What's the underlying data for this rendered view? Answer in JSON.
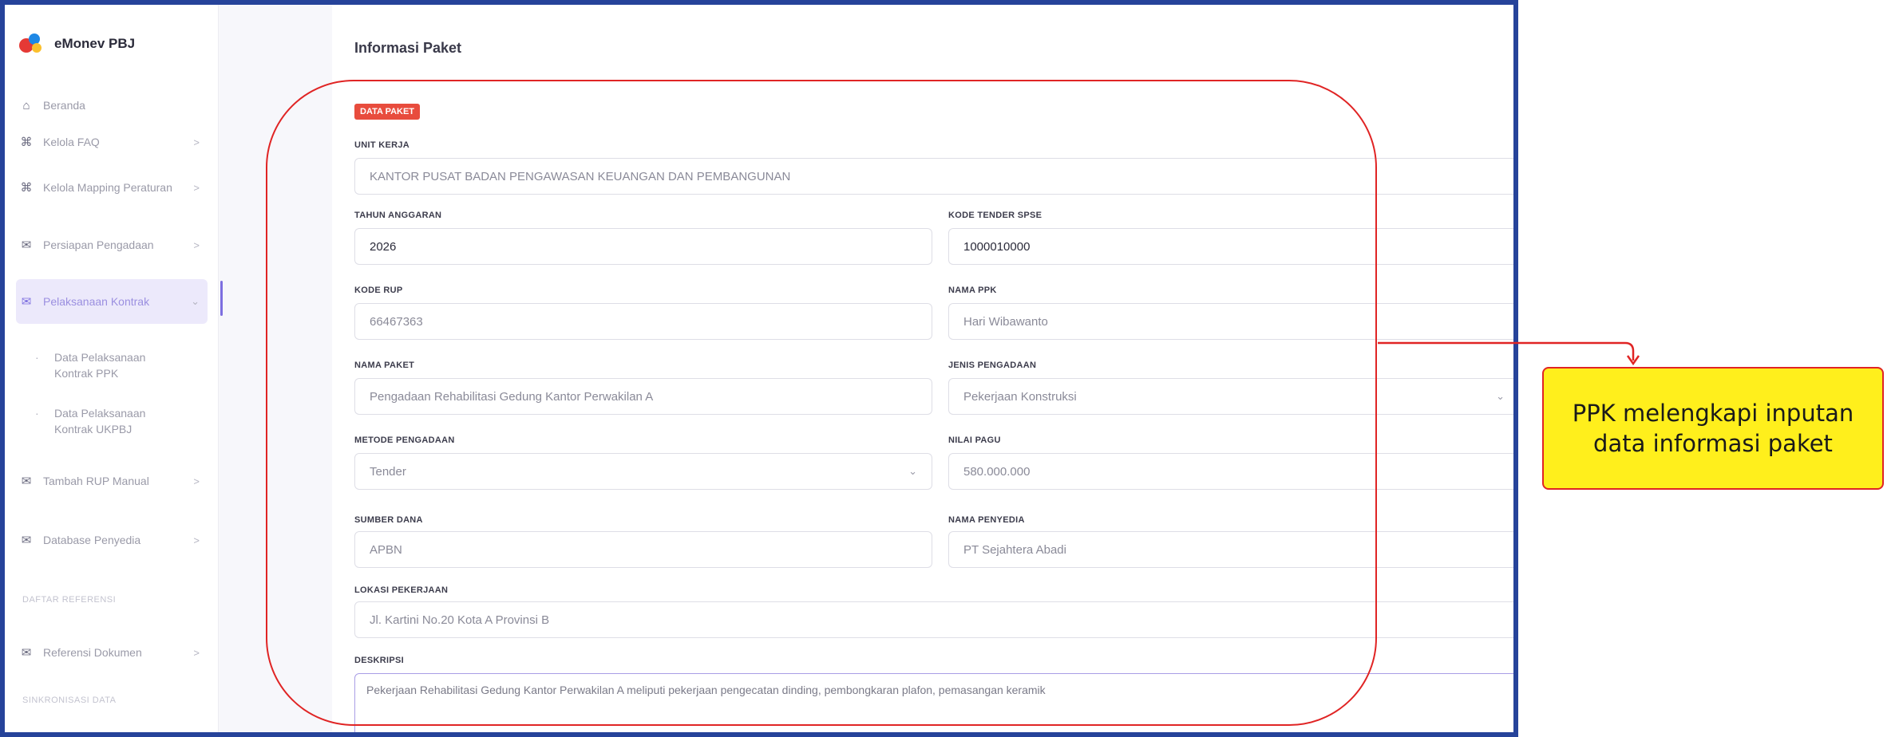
{
  "app": {
    "name": "eMonev PBJ"
  },
  "sidebar": {
    "items": [
      {
        "label": "Beranda",
        "icon": "home-icon",
        "has_chevron": false
      },
      {
        "label": "Kelola FAQ",
        "icon": "command-icon",
        "has_chevron": true
      },
      {
        "label": "Kelola Mapping Peraturan",
        "icon": "command-icon",
        "has_chevron": true
      },
      {
        "label": "Persiapan Pengadaan",
        "icon": "mail-icon",
        "has_chevron": true
      },
      {
        "label": "Pelaksanaan Kontrak",
        "icon": "mail-icon",
        "has_chevron": true,
        "active": true
      },
      {
        "label": "Data Pelaksanaan Kontrak PPK",
        "sub": true
      },
      {
        "label": "Data Pelaksanaan Kontrak UKPBJ",
        "sub": true
      },
      {
        "label": "Tambah RUP Manual",
        "icon": "mail-icon",
        "has_chevron": true
      },
      {
        "label": "Database Penyedia",
        "icon": "mail-icon",
        "has_chevron": true
      },
      {
        "label": "Referensi Dokumen",
        "icon": "mail-icon",
        "has_chevron": true
      }
    ],
    "sections": [
      "DAFTAR REFERENSI",
      "SINKRONISASI DATA"
    ],
    "chevron_glyph": ">",
    "chevron_down_glyph": "⌄"
  },
  "main": {
    "section_title": "Informasi Paket",
    "badge": "DATA PAKET",
    "fields": {
      "unit_kerja": {
        "label": "UNIT KERJA",
        "value": "KANTOR PUSAT BADAN PENGAWASAN KEUANGAN DAN PEMBANGUNAN"
      },
      "tahun_anggaran": {
        "label": "TAHUN ANGGARAN",
        "value": "2026"
      },
      "kode_tender": {
        "label": "KODE TENDER SPSE",
        "value": "1000010000"
      },
      "kode_rup": {
        "label": "KODE RUP",
        "value": "66467363"
      },
      "nama_ppk": {
        "label": "NAMA PPK",
        "value": "Hari Wibawanto"
      },
      "nama_paket": {
        "label": "NAMA PAKET",
        "value": "Pengadaan Rehabilitasi Gedung Kantor Perwakilan A"
      },
      "jenis_pengadaan": {
        "label": "JENIS PENGADAAN",
        "value": "Pekerjaan Konstruksi"
      },
      "metode_pengadaan": {
        "label": "METODE PENGADAAN",
        "value": "Tender"
      },
      "nilai_pagu": {
        "label": "NILAI PAGU",
        "value": "580.000.000"
      },
      "sumber_dana": {
        "label": "SUMBER DANA",
        "value": "APBN"
      },
      "nama_penyedia": {
        "label": "NAMA PENYEDIA",
        "value": "PT Sejahtera Abadi"
      },
      "lokasi": {
        "label": "LOKASI PEKERJAAN",
        "value": "Jl. Kartini No.20 Kota A Provinsi B"
      },
      "deskripsi": {
        "label": "DESKRIPSI",
        "value": "Pekerjaan Rehabilitasi Gedung Kantor Perwakilan A meliputi pekerjaan pengecatan dinding, pembongkaran plafon, pemasangan keramik"
      }
    },
    "select_caret": "⌄"
  },
  "annotation": {
    "callout_line1": "PPK melengkapi inputan",
    "callout_line2": "data informasi paket",
    "colors": {
      "outline": "#e02424",
      "callout_bg": "#ffef1c",
      "frame": "#26439a"
    }
  }
}
